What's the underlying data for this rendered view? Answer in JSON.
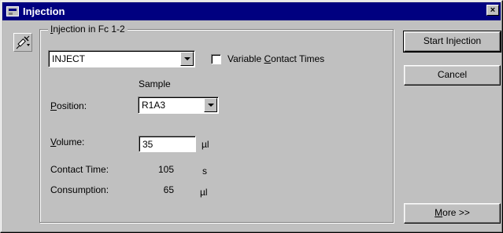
{
  "window": {
    "title": "Injection",
    "close_glyph": "×"
  },
  "group": {
    "legend_mnemonic": "I",
    "legend_rest": "njection in Fc 1-2"
  },
  "command_select": {
    "value": "INJECT"
  },
  "variable_contact": {
    "label_pre": "Variable ",
    "label_mnemonic": "C",
    "label_post": "ontact Times",
    "checked": false
  },
  "sample": {
    "header": "Sample",
    "position_mnemonic": "P",
    "position_rest": "osition:",
    "position_value": "R1A3"
  },
  "volume": {
    "label_mnemonic": "V",
    "label_rest": "olume:",
    "value": "35",
    "unit": "µl"
  },
  "contact_time": {
    "label": "Contact Time:",
    "value": "105",
    "unit": "s"
  },
  "consumption": {
    "label": "Consumption:",
    "value": "65",
    "unit": "µl"
  },
  "buttons": {
    "start": "Start Injection",
    "cancel": "Cancel",
    "more_mnemonic": "M",
    "more_rest": "ore >>"
  },
  "icons": {
    "app": "window-app-icon",
    "side": "syringe-icon",
    "close": "close-icon"
  },
  "colors": {
    "titlebar": "#000080",
    "face": "#c0c0c0"
  }
}
